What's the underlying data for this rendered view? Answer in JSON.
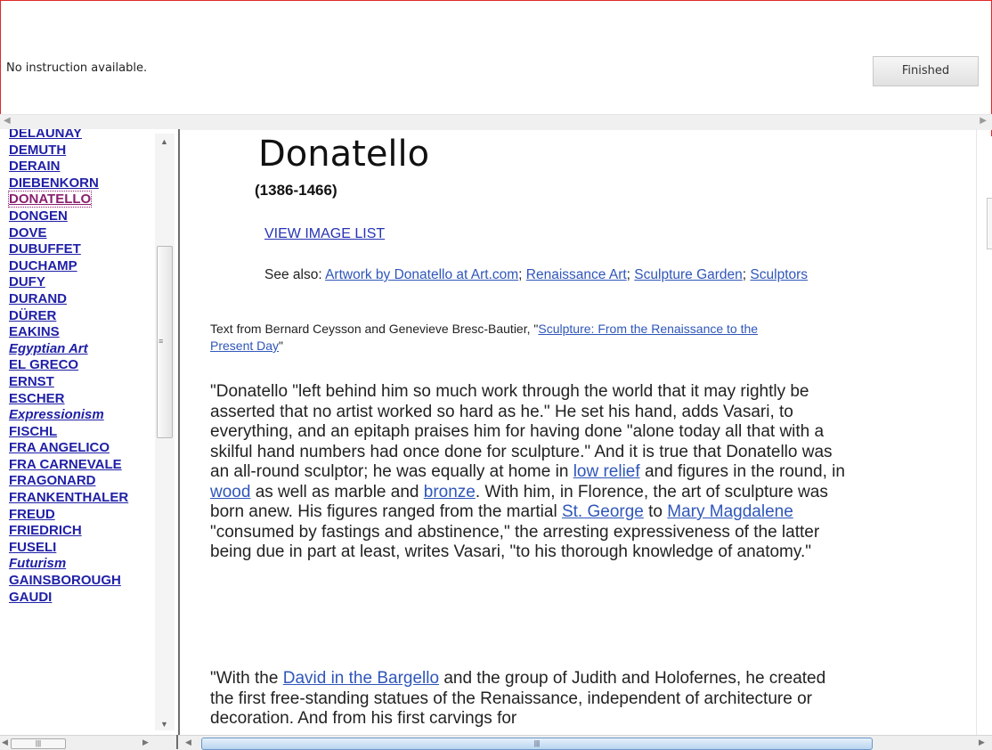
{
  "instruction_text": "No instruction available.",
  "finished_label": "Finished",
  "sidebar": {
    "items": [
      {
        "label": "DELAUNAY",
        "italic": false,
        "selected": false
      },
      {
        "label": "DEMUTH",
        "italic": false,
        "selected": false
      },
      {
        "label": "DERAIN",
        "italic": false,
        "selected": false
      },
      {
        "label": "DIEBENKORN",
        "italic": false,
        "selected": false
      },
      {
        "label": "DONATELLO",
        "italic": false,
        "selected": true
      },
      {
        "label": "DONGEN",
        "italic": false,
        "selected": false
      },
      {
        "label": "DOVE",
        "italic": false,
        "selected": false
      },
      {
        "label": "DUBUFFET",
        "italic": false,
        "selected": false
      },
      {
        "label": "DUCHAMP",
        "italic": false,
        "selected": false
      },
      {
        "label": "DUFY",
        "italic": false,
        "selected": false
      },
      {
        "label": "DURAND",
        "italic": false,
        "selected": false
      },
      {
        "label": "DÜRER",
        "italic": false,
        "selected": false
      },
      {
        "label": "EAKINS",
        "italic": false,
        "selected": false
      },
      {
        "label": "Egyptian Art",
        "italic": true,
        "selected": false
      },
      {
        "label": "EL GRECO",
        "italic": false,
        "selected": false
      },
      {
        "label": "ERNST",
        "italic": false,
        "selected": false
      },
      {
        "label": "ESCHER",
        "italic": false,
        "selected": false
      },
      {
        "label": "Expressionism",
        "italic": true,
        "selected": false
      },
      {
        "label": "FISCHL",
        "italic": false,
        "selected": false
      },
      {
        "label": "FRA ANGELICO",
        "italic": false,
        "selected": false
      },
      {
        "label": "FRA CARNEVALE",
        "italic": false,
        "selected": false
      },
      {
        "label": "FRAGONARD",
        "italic": false,
        "selected": false
      },
      {
        "label": "FRANKENTHALER",
        "italic": false,
        "selected": false
      },
      {
        "label": "FREUD",
        "italic": false,
        "selected": false
      },
      {
        "label": "FRIEDRICH",
        "italic": false,
        "selected": false
      },
      {
        "label": "FUSELI",
        "italic": false,
        "selected": false
      },
      {
        "label": "Futurism",
        "italic": true,
        "selected": false
      },
      {
        "label": "GAINSBOROUGH",
        "italic": false,
        "selected": false
      },
      {
        "label": "GAUDI",
        "italic": false,
        "selected": false
      }
    ]
  },
  "main": {
    "artist_name": "Donatello",
    "artist_dates": "(1386-1466)",
    "view_image_list": "VIEW IMAGE LIST",
    "see_also_prefix": "See also: ",
    "see_also_links": [
      "Artwork by Donatello at Art.com",
      "Renaissance Art",
      "Sculpture Garden",
      "Sculptors"
    ],
    "source_prefix": "Text from Bernard Ceysson and Genevieve Bresc-Bautier, ",
    "source_link": "Sculpture: From the Renaissance to the Present Day",
    "paragraph1": [
      {
        "t": "\"Donatello \"left behind him so much work through the world that it may rightly be asserted that no artist worked so hard as he.\" He set his hand, adds Vasari, to everything, and an epitaph praises him for having done \"alone today all that with a skilful hand numbers had once done for sculpture.\" And it is true that Donatello was an all-round sculptor; he was equally at home in "
      },
      {
        "t": "low relief",
        "link": true
      },
      {
        "t": " and figures in the round, in "
      },
      {
        "t": "wood",
        "link": true
      },
      {
        "t": " as well as marble and "
      },
      {
        "t": "bronze",
        "link": true
      },
      {
        "t": ". With him, in Florence, the art of sculpture was born anew. His figures ranged from the martial "
      },
      {
        "t": "St. George",
        "link": true
      },
      {
        "t": " to "
      },
      {
        "t": "Mary Magdalene",
        "link": true
      },
      {
        "t": " \"consumed by fastings and abstinence,\" the arresting expressiveness of the latter being due in part at least, writes Vasari, \"to his thorough knowledge of anatomy.\""
      }
    ],
    "paragraph2": [
      {
        "t": "\"With the "
      },
      {
        "t": "David in the Bargello",
        "link": true
      },
      {
        "t": " and the group of Judith and Holofernes, he created the first free-standing statues of the Renaissance, independent of architecture or decoration. And from his first carvings for"
      }
    ]
  }
}
